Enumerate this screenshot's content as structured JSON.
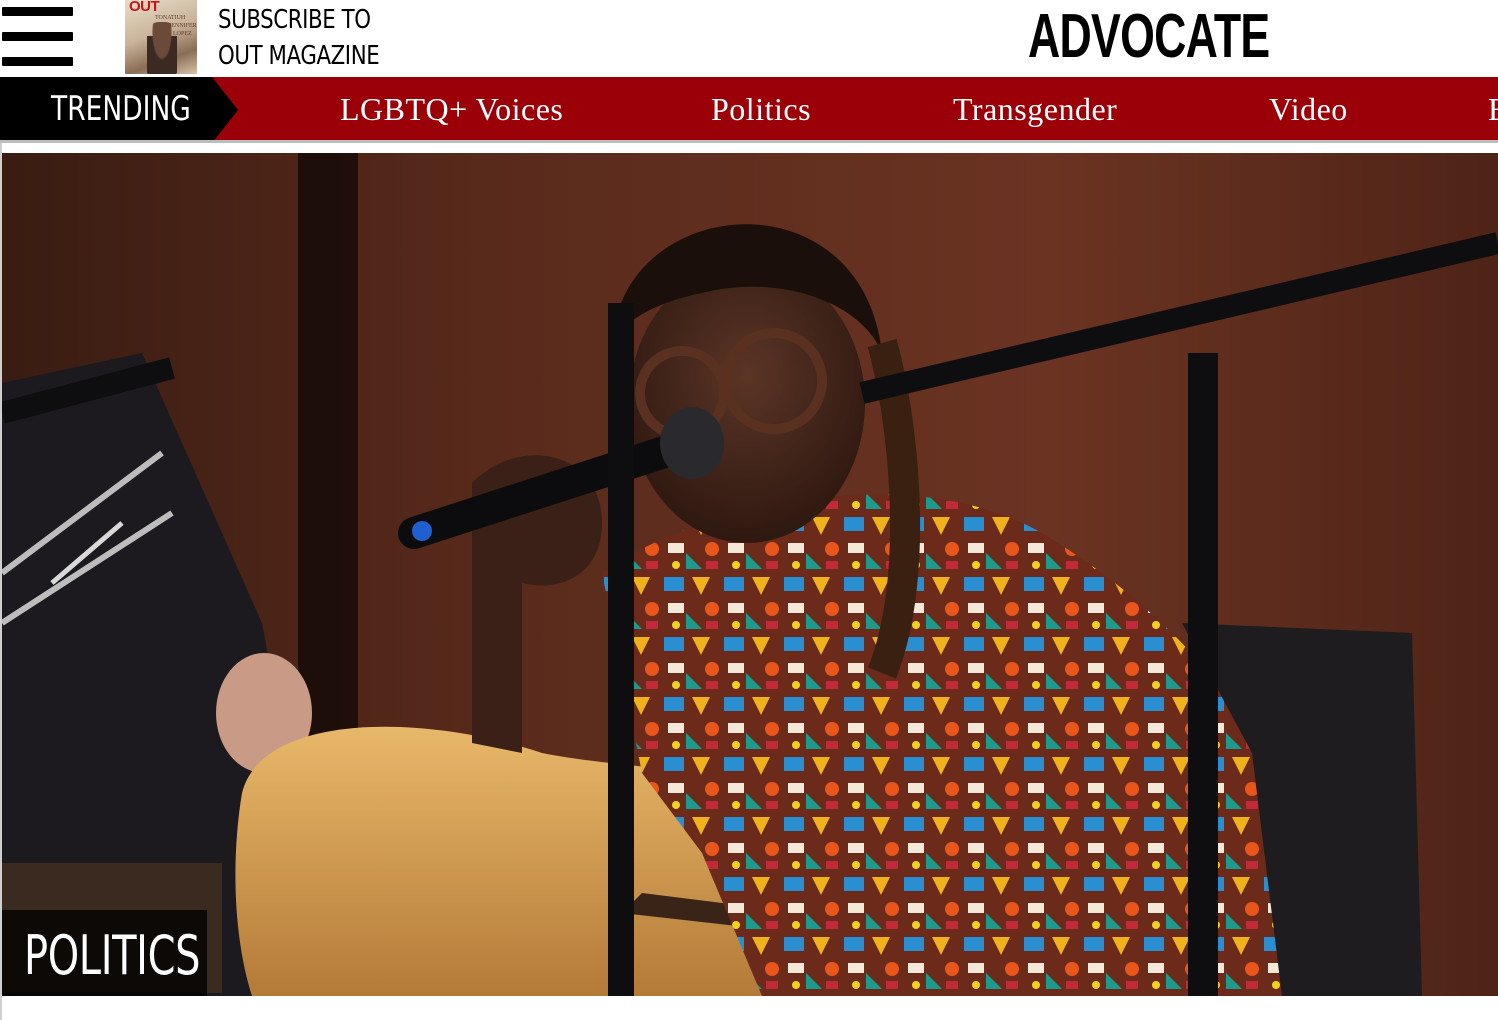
{
  "header": {
    "subscribe_line1": "SUBSCRIBE TO",
    "subscribe_line2": "OUT MAGAZINE",
    "cover_logo": "OUT",
    "cover_line1": "TONATIUH",
    "cover_line2": "JENNIFER",
    "cover_line3": "LOPEZ",
    "brand": "ADVOCATE"
  },
  "nav": {
    "trending_label": "TRENDING",
    "items": [
      {
        "label": "LGBTQ+ Voices"
      },
      {
        "label": "Politics"
      },
      {
        "label": "Transgender"
      },
      {
        "label": "Video"
      },
      {
        "label": "E"
      }
    ]
  },
  "hero": {
    "category": "POLITICS"
  },
  "colors": {
    "nav_background": "#9b0008",
    "trending_background": "#000000",
    "text_primary": "#000000"
  },
  "icons": {
    "menu": "hamburger-menu-icon",
    "magazine": "magazine-cover-thumbnail"
  }
}
